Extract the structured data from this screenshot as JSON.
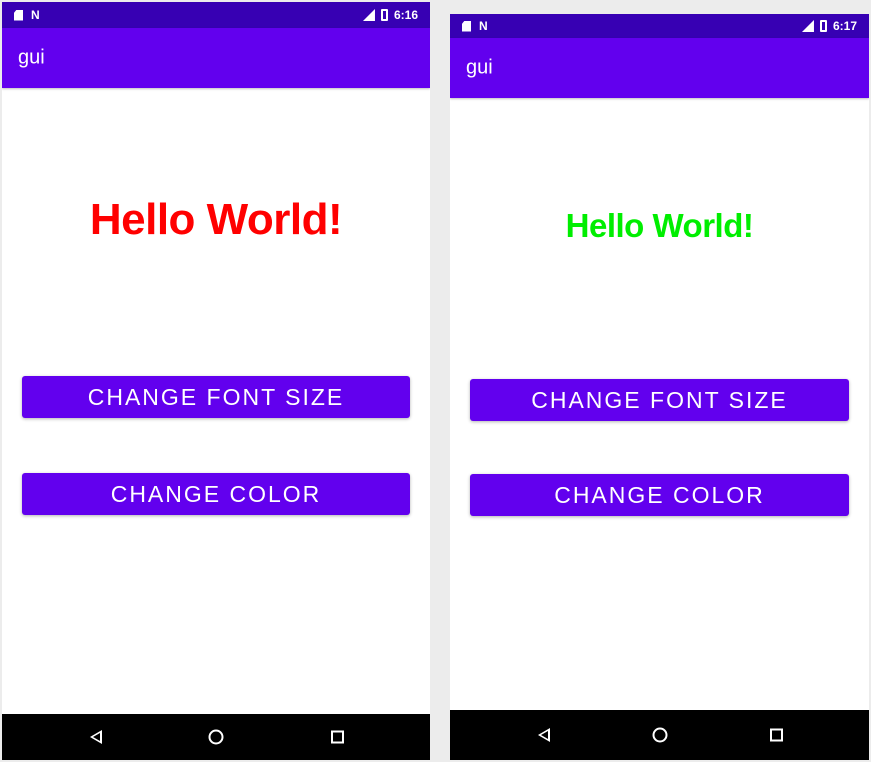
{
  "screens": [
    {
      "status_time": "6:16",
      "app_title": "gui",
      "hello_text": "Hello World!",
      "hello_color": "#ff0000",
      "button_font_label": "CHANGE FONT SIZE",
      "button_color_label": "CHANGE COLOR"
    },
    {
      "status_time": "6:17",
      "app_title": "gui",
      "hello_text": "Hello World!",
      "hello_color": "#00ee00",
      "button_font_label": "CHANGE FONT SIZE",
      "button_color_label": "CHANGE COLOR"
    }
  ],
  "colors": {
    "status_bar": "#3700b3",
    "app_bar": "#6200ee",
    "button": "#6200ee",
    "nav_bar": "#000000"
  },
  "icons": {
    "status_left": [
      "sd-card-icon",
      "n-notification-icon"
    ],
    "status_right": [
      "signal-icon",
      "battery-icon"
    ],
    "nav": [
      "back-icon",
      "home-icon",
      "recents-icon"
    ]
  }
}
